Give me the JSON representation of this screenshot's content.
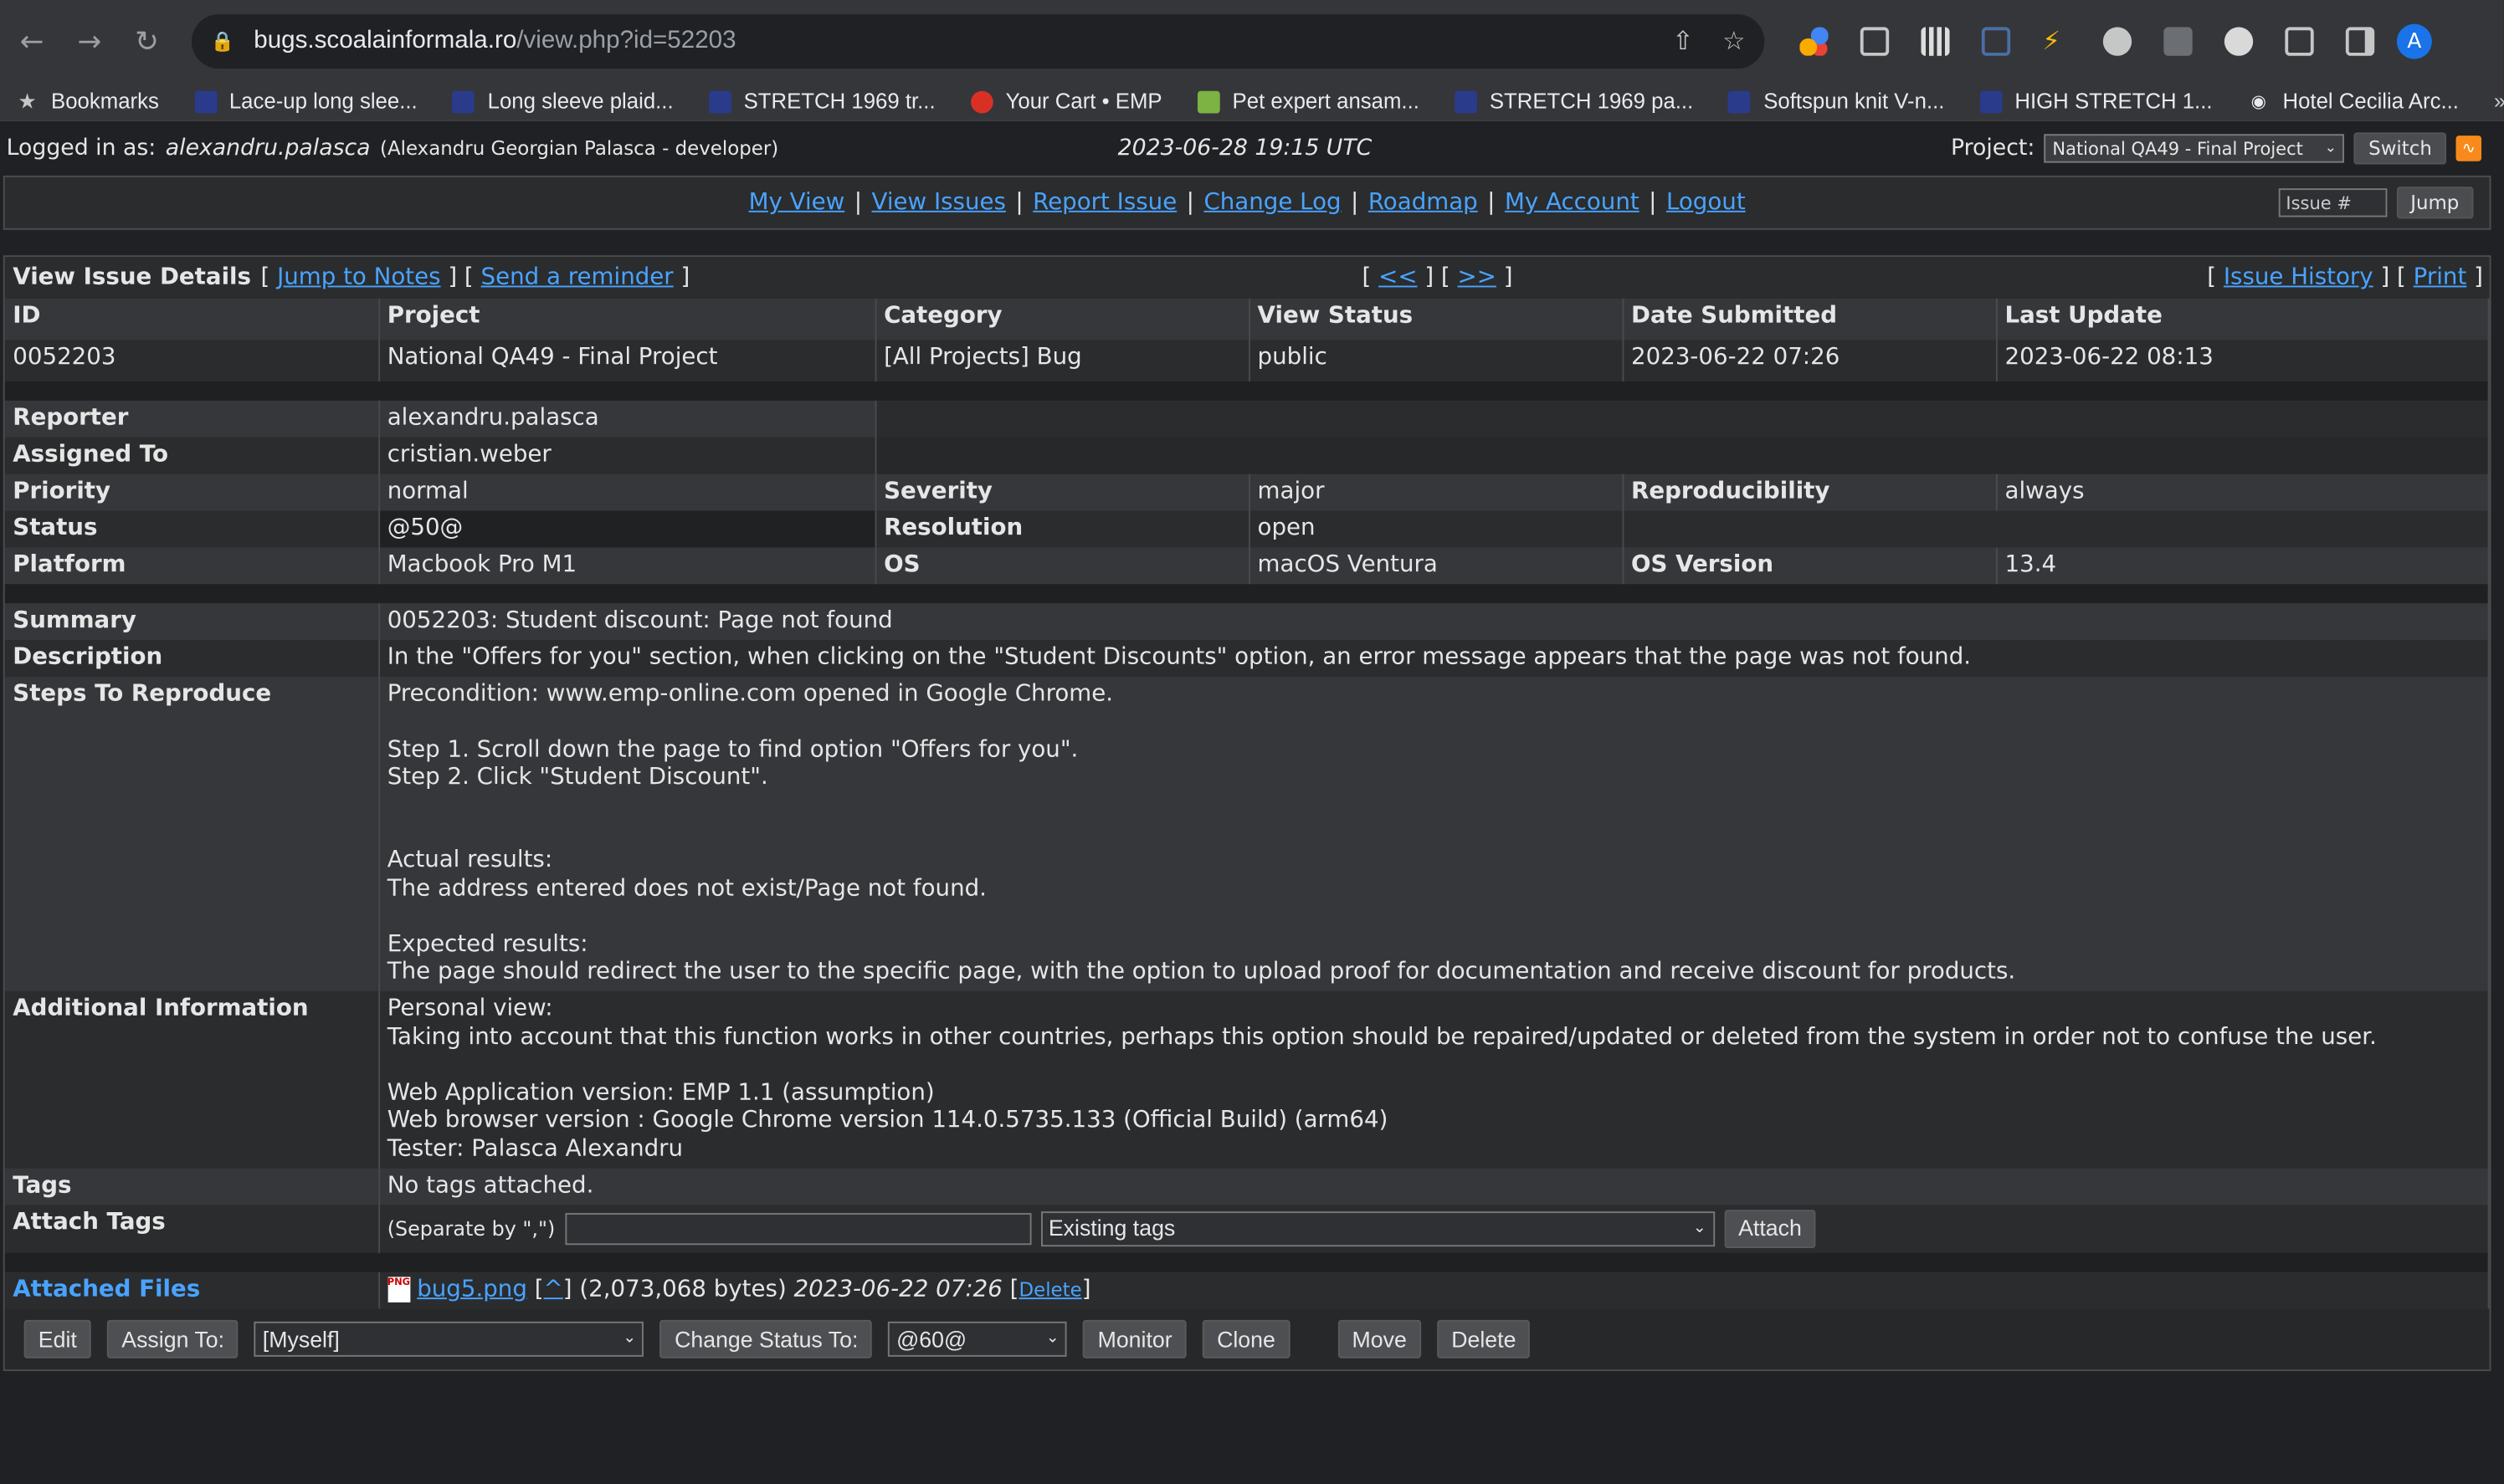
{
  "browser": {
    "url_host": "bugs.scoalainformala.ro",
    "url_path": "/view.php?id=52203",
    "avatar_letter": "A",
    "bookmarks": [
      {
        "label": "Bookmarks",
        "icon": "star-icon"
      },
      {
        "label": "Lace-up long slee...",
        "icon": "emp-icon"
      },
      {
        "label": "Long sleeve plaid...",
        "icon": "emp-icon"
      },
      {
        "label": "STRETCH 1969 tr...",
        "icon": "emp-icon"
      },
      {
        "label": "Your Cart • EMP",
        "icon": "emp-cart-icon"
      },
      {
        "label": "Pet expert ansam...",
        "icon": "pet-icon"
      },
      {
        "label": "STRETCH 1969 pa...",
        "icon": "emp-icon"
      },
      {
        "label": "Softspun knit V-n...",
        "icon": "emp-icon"
      },
      {
        "label": "HIGH STRETCH 1...",
        "icon": "emp-icon"
      },
      {
        "label": "Hotel Cecilia Arc...",
        "icon": "tripadvisor-icon"
      }
    ]
  },
  "header": {
    "logged_in_label": "Logged in as:",
    "username": "alexandru.palasca",
    "user_full": "(Alexandru Georgian Palasca - developer)",
    "datetime": "2023-06-28 19:15 UTC",
    "project_label": "Project:",
    "project_selected": "National QA49 - Final Project",
    "switch_label": "Switch"
  },
  "menu": {
    "items": [
      "My View",
      "View Issues",
      "Report Issue",
      "Change Log",
      "Roadmap",
      "My Account",
      "Logout"
    ],
    "jump_placeholder": "Issue #",
    "jump_label": "Jump"
  },
  "issue": {
    "title": "View Issue Details",
    "jump_notes": "Jump to Notes",
    "send_reminder": "Send a reminder",
    "prev": "<<",
    "next": ">>",
    "history": "Issue History",
    "print": "Print",
    "columns": [
      "ID",
      "Project",
      "Category",
      "View Status",
      "Date Submitted",
      "Last Update"
    ],
    "values": [
      "0052203",
      "National QA49 - Final Project",
      "[All Projects] Bug",
      "public",
      "2023-06-22 07:26",
      "2023-06-22 08:13"
    ],
    "reporter_label": "Reporter",
    "reporter": "alexandru.palasca",
    "assigned_label": "Assigned To",
    "assigned": "cristian.weber",
    "priority_label": "Priority",
    "priority": "normal",
    "severity_label": "Severity",
    "severity": "major",
    "repro_label": "Reproducibility",
    "repro": "always",
    "status_label": "Status",
    "status": "@50@",
    "resolution_label": "Resolution",
    "resolution": "open",
    "platform_label": "Platform",
    "platform": "Macbook Pro M1",
    "os_label": "OS",
    "os": "macOS Ventura",
    "osver_label": "OS Version",
    "osver": "13.4",
    "summary_label": "Summary",
    "summary": "0052203: Student discount: Page not found",
    "description_label": "Description",
    "description": "In the \"Offers for you\" section, when clicking on the \"Student Discounts\" option, an error message appears that the page was not found.",
    "steps_label": "Steps To Reproduce",
    "steps": "Precondition: www.emp-online.com opened in Google Chrome.\n\nStep 1. Scroll down the page to find option \"Offers for you\".\nStep 2. Click \"Student Discount\".\n\n\nActual results:\nThe address entered does not exist/Page not found.\n\nExpected results:\nThe page should redirect the user to the specific page, with the option to upload proof for documentation and receive discount for products.",
    "addinfo_label": "Additional Information",
    "addinfo": "Personal view:\nTaking into account that this function works in other countries, perhaps this option should be repaired/updated or deleted from the system in order not to confuse the user.\n\nWeb Application version: EMP 1.1 (assumption)\nWeb browser version : Google Chrome version 114.0.5735.133 (Official Build) (arm64)\nTester: Palasca Alexandru",
    "tags_label": "Tags",
    "tags": "No tags attached.",
    "attach_tags_label": "Attach Tags",
    "separate_hint": "(Separate by \",\")",
    "existing_tags": "Existing tags",
    "attach_label": "Attach",
    "files_label": "Attached Files",
    "file_name": "bug5.png",
    "file_caret": "^",
    "file_size": "(2,073,068 bytes)",
    "file_date": "2023-06-22 07:26",
    "file_delete": "Delete"
  },
  "actions": {
    "edit": "Edit",
    "assign_to": "Assign To:",
    "assign_value": "[Myself]",
    "change_status": "Change Status To:",
    "status_value": "@60@",
    "monitor": "Monitor",
    "clone": "Clone",
    "move": "Move",
    "delete": "Delete"
  }
}
